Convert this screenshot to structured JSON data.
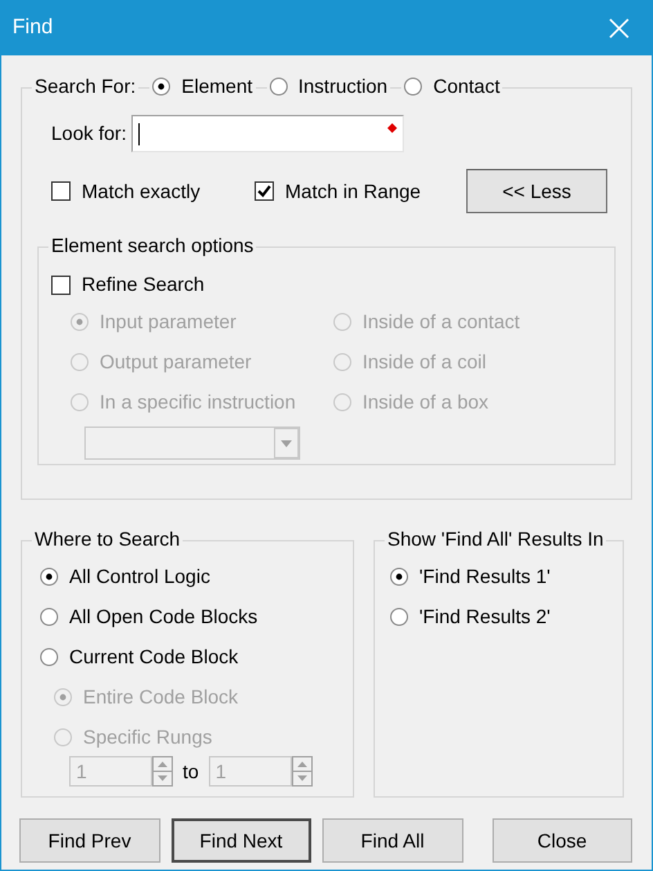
{
  "window": {
    "title": "Find"
  },
  "search_for": {
    "label": "Search For:",
    "options": [
      {
        "label": "Element",
        "selected": true
      },
      {
        "label": "Instruction",
        "selected": false
      },
      {
        "label": "Contact",
        "selected": false
      }
    ]
  },
  "look_for": {
    "label": "Look for:",
    "required": true
  },
  "match_options": [
    {
      "label": "Match exactly",
      "checked": false
    },
    {
      "label": "Match in Range",
      "checked": true
    }
  ],
  "less_button": "<< Less",
  "element_search_options": {
    "title": "Element search options",
    "refine": {
      "label": "Refine Search",
      "checked": false
    },
    "disabled": true,
    "choices": [
      {
        "label": "Input parameter",
        "selected": true
      },
      {
        "label": "Inside of a contact",
        "selected": false
      },
      {
        "label": "Output parameter",
        "selected": false
      },
      {
        "label": "Inside of a coil",
        "selected": false
      },
      {
        "label": "In a specific instruction",
        "selected": false
      },
      {
        "label": "Inside of a box",
        "selected": false
      }
    ]
  },
  "where_to_search": {
    "title": "Where to Search",
    "options": [
      {
        "label": "All Control Logic",
        "selected": true
      },
      {
        "label": "All Open Code Blocks",
        "selected": false
      },
      {
        "label": "Current Code Block",
        "selected": false
      }
    ],
    "sub_disabled": true,
    "sub_options": [
      {
        "label": "Entire Code Block",
        "selected": true
      },
      {
        "label": "Specific Rungs",
        "selected": false
      }
    ],
    "range": {
      "from": "1",
      "to_label": "to",
      "to": "1"
    }
  },
  "results_in": {
    "title": "Show 'Find All' Results In",
    "options": [
      {
        "label": "'Find Results 1'",
        "selected": true
      },
      {
        "label": "'Find Results 2'",
        "selected": false
      }
    ]
  },
  "buttons": [
    {
      "label": "Find Prev",
      "default": false
    },
    {
      "label": "Find Next",
      "default": true
    },
    {
      "label": "Find All",
      "default": false
    },
    {
      "label": "Close",
      "default": false
    }
  ]
}
